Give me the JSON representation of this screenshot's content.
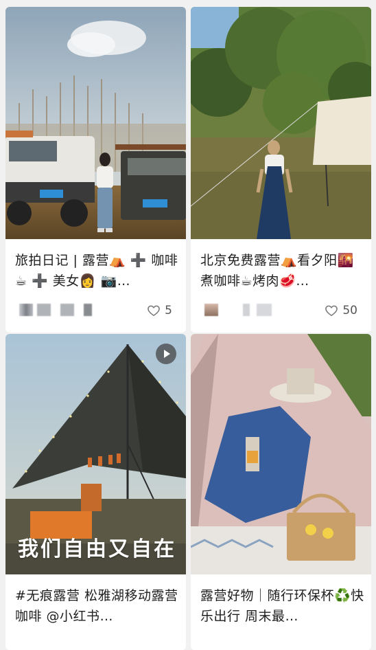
{
  "feed": {
    "cards": [
      {
        "title": "旅拍日记 | 露营⛺ ➕ 咖啡☕ ➕ 美女👩 📷…",
        "likes": "5",
        "image": "jeeps-camping-photo"
      },
      {
        "title": "北京免费露营⛺看夕阳🌇煮咖啡☕烤肉🥩…",
        "likes": "50",
        "image": "woman-overalls-tent-photo"
      },
      {
        "title": "#无痕露营 松雅湖移动露营咖啡 @小红书…",
        "likes": "",
        "image": "tarp-tent-photo",
        "overlay_text": "我们自由又自在",
        "has_video": true
      },
      {
        "title": "露营好物｜随行环保杯♻️快乐出行 周末最…",
        "likes": "",
        "image": "bucket-hat-tent-photo"
      }
    ]
  },
  "icons": {
    "like": "heart-outline-icon",
    "video": "play-icon"
  },
  "colors": {
    "background": "#f1f1f1",
    "card": "#ffffff",
    "text": "#1f1f1f",
    "muted": "#555555"
  }
}
